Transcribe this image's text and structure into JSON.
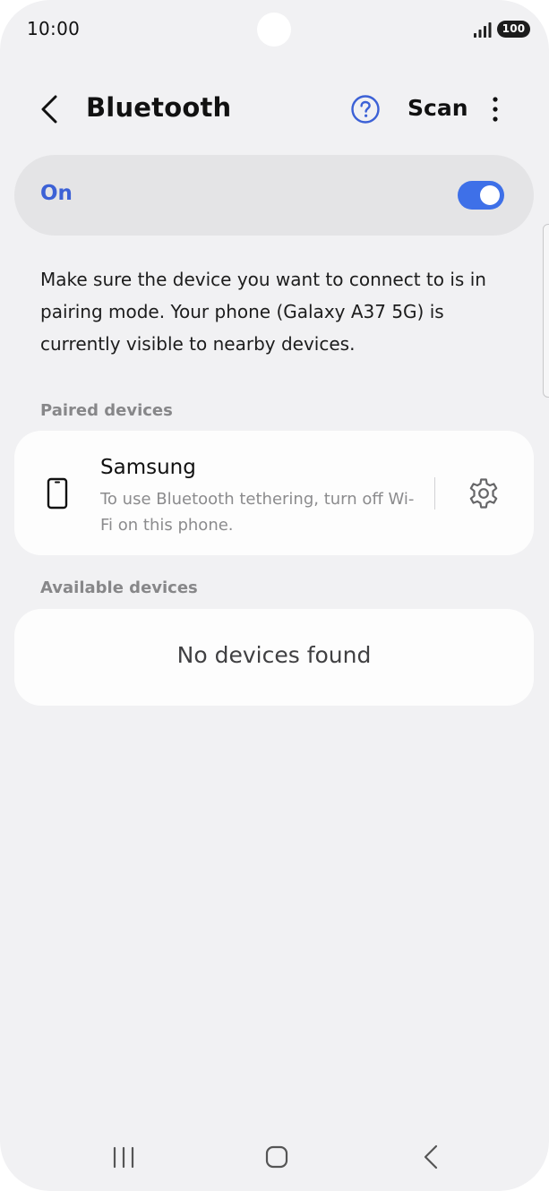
{
  "status_bar": {
    "time": "10:00",
    "battery": "100",
    "icons": [
      "signal-icon",
      "battery-icon"
    ]
  },
  "header": {
    "title": "Bluetooth",
    "scan_label": "Scan",
    "icons": [
      "back-arrow-icon",
      "help-icon",
      "more-vertical-icon"
    ]
  },
  "toggle": {
    "label": "On",
    "state": "on",
    "accent_color": "#3e70e8",
    "label_color": "#3c61d6"
  },
  "description": "Make sure the device you want to connect to is in pairing mode. Your phone (Galaxy A37 5G) is currently visible to nearby devices.",
  "paired_section": {
    "title": "Paired devices",
    "devices": [
      {
        "name": "Samsung",
        "subtitle": "To use Bluetooth tethering, turn off Wi-Fi on this phone.",
        "icon": "phone-icon",
        "settings_icon": "gear-icon"
      }
    ]
  },
  "available_section": {
    "title": "Available devices",
    "empty_text": "No devices found"
  },
  "nav_bar": {
    "icons": [
      "recents-icon",
      "home-icon",
      "back-icon"
    ]
  }
}
